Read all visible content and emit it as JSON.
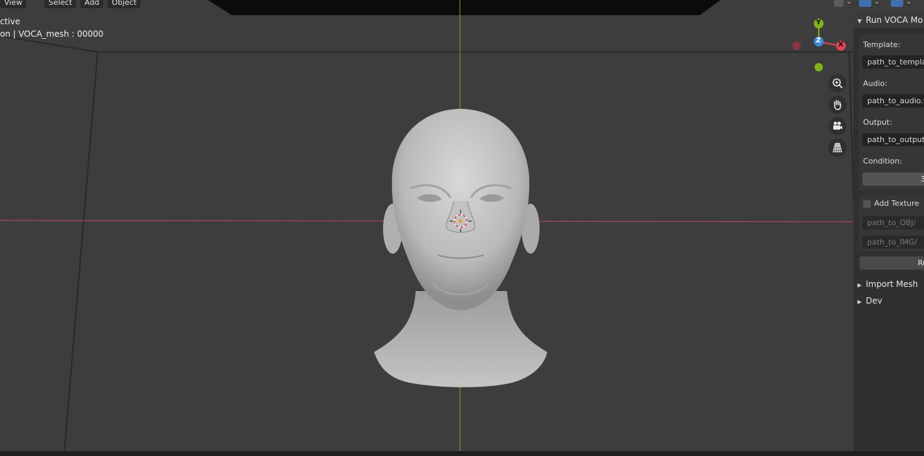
{
  "header_menu": [
    "View",
    "Select",
    "Add",
    "Object"
  ],
  "viewport": {
    "mode_line1": "ctive",
    "mode_line2": "on | VOCA_mesh : 00000"
  },
  "gizmo": {
    "y_label": "Y",
    "z_label": "Z",
    "x_label": "X"
  },
  "nav_icons": [
    "zoom-icon",
    "pan-hand-icon",
    "camera-icon",
    "grid-perspective-icon"
  ],
  "panel": {
    "title": "Run VOCA Mo",
    "template_label": "Template:",
    "template_value": "path_to_templat",
    "audio_label": "Audio:",
    "audio_value": "path_to_audio.w",
    "output_label": "Output:",
    "output_value": "path_to_output_r",
    "condition_label": "Condition:",
    "condition_value": "3",
    "add_texture_label": "Add Texture",
    "obj_placeholder": "path_to_OBJ/",
    "img_placeholder": "path_to_IMG/",
    "run_label": "Ru",
    "import_mesh_label": "Import Mesh",
    "dev_label": "Dev"
  },
  "colors": {
    "background": "#3d3d3d",
    "x_axis": "#c0485a",
    "y_axis": "#7ea52b",
    "gizmo_x": "#e34358",
    "gizmo_y": "#7fb21a",
    "gizmo_z": "#3d86d8",
    "panel_bg": "#303030"
  }
}
